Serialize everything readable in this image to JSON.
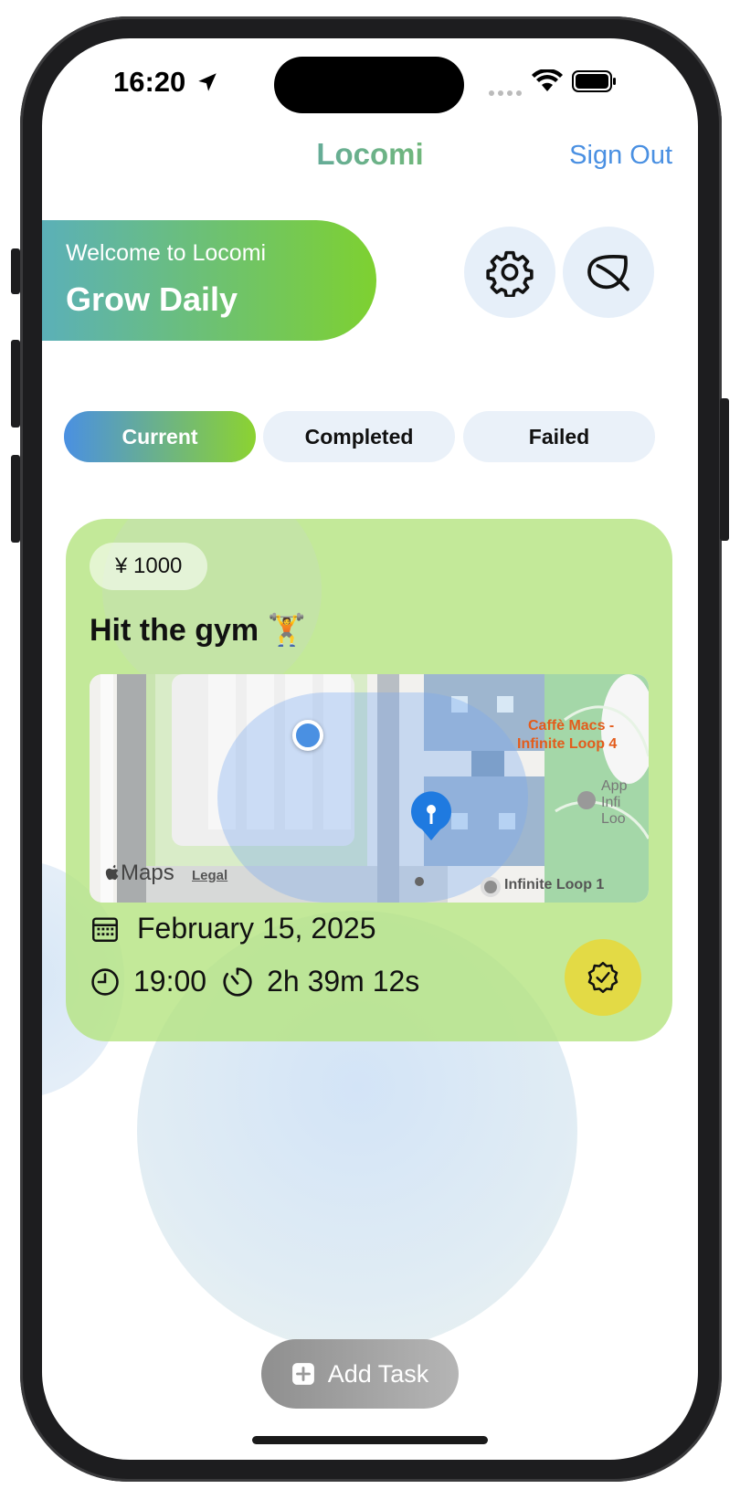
{
  "status_bar": {
    "time": "16:20"
  },
  "header": {
    "title": "Locomi",
    "sign_out": "Sign Out"
  },
  "welcome": {
    "subtitle": "Welcome to Locomi",
    "title": "Grow Daily"
  },
  "icons": {
    "settings": "gear-icon",
    "leaf": "leaf-icon"
  },
  "tabs": [
    {
      "label": "Current",
      "active": true
    },
    {
      "label": "Completed",
      "active": false
    },
    {
      "label": "Failed",
      "active": false
    }
  ],
  "task": {
    "reward": "¥ 1000",
    "title": "Hit the gym 🏋️",
    "map": {
      "attribution": "Maps",
      "legal": "Legal",
      "poi_cafe_line1": "Caffè Macs -",
      "poi_cafe_line2": "Infinite Loop 4",
      "poi_app_line1": "App",
      "poi_app_line2": "Infi",
      "poi_app_line3": "Loo",
      "street_label": "Infinite Loop 1"
    },
    "date": "February 15, 2025",
    "time": "19:00",
    "remaining": "2h 39m 12s"
  },
  "add_task": {
    "label": "Add Task"
  },
  "colors": {
    "accent_blue": "#4a90e2",
    "accent_green": "#8cd330",
    "card_green": "#b4e480",
    "badge_yellow": "#e3da45"
  }
}
